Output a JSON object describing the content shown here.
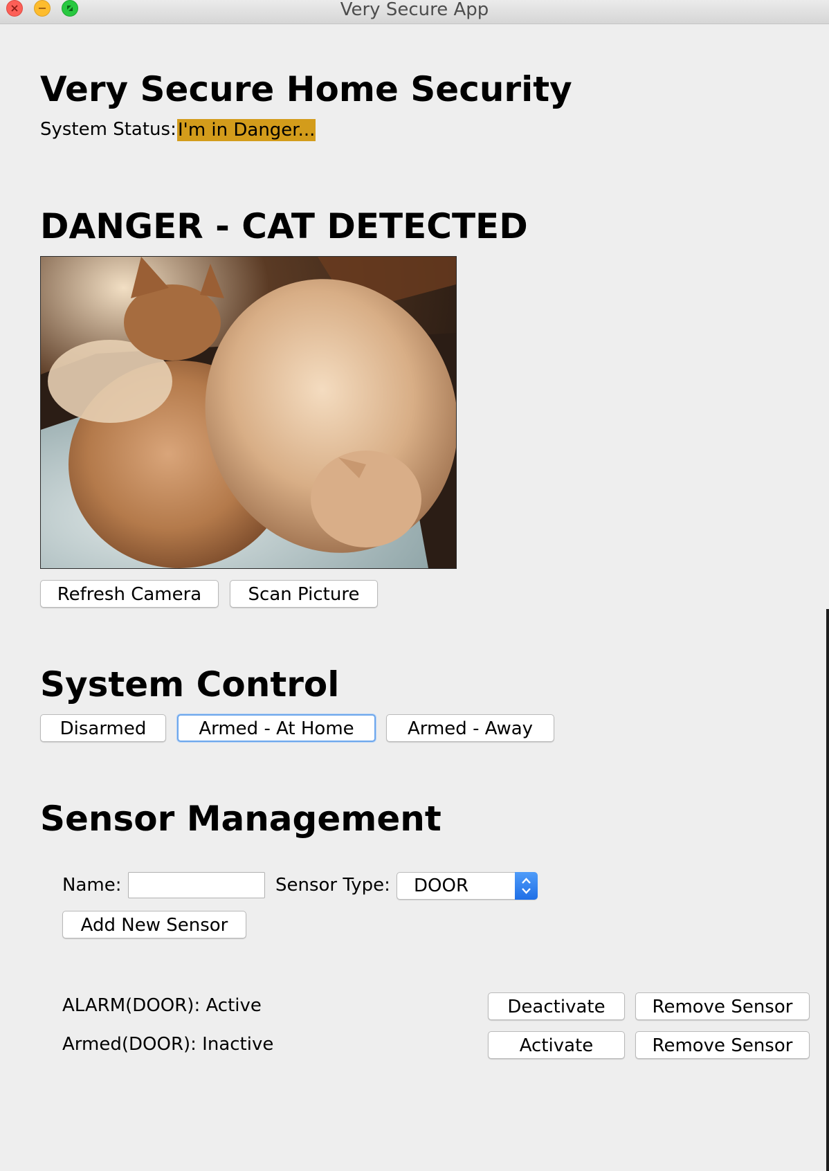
{
  "window": {
    "title": "Very Secure App"
  },
  "header": {
    "title": "Very Secure Home Security",
    "status_label": "System Status:",
    "status_value": "I'm in Danger...",
    "status_color": "#d39c1b"
  },
  "camera": {
    "heading": "DANGER - CAT DETECTED",
    "refresh_label": "Refresh Camera",
    "scan_label": "Scan Picture"
  },
  "system_control": {
    "heading": "System Control",
    "buttons": [
      "Disarmed",
      "Armed - At Home",
      "Armed - Away"
    ],
    "focused": "Armed - At Home"
  },
  "sensor_management": {
    "heading": "Sensor Management",
    "name_label": "Name:",
    "name_value": "",
    "type_label": "Sensor Type:",
    "type_value": "DOOR",
    "add_label": "Add New Sensor",
    "sensors": [
      {
        "status": "ALARM(DOOR): Active",
        "toggle_label": "Deactivate",
        "remove_label": "Remove Sensor"
      },
      {
        "status": "Armed(DOOR): Inactive",
        "toggle_label": "Activate",
        "remove_label": "Remove Sensor"
      }
    ]
  },
  "icons": {
    "close": "close-icon",
    "minimize": "minimize-icon",
    "maximize": "maximize-icon",
    "select_arrows": "chevron-updown-icon"
  }
}
